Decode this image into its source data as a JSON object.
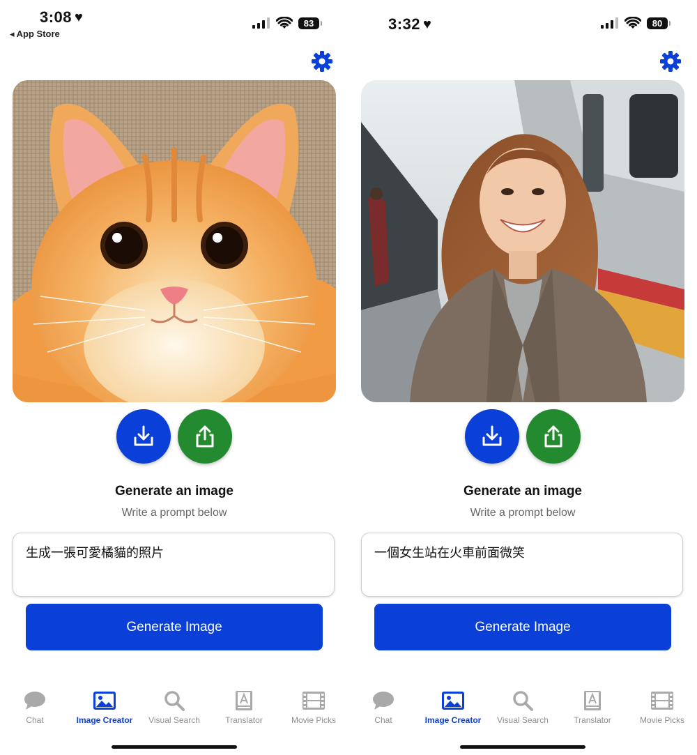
{
  "screens": [
    {
      "status": {
        "time": "3:08",
        "battery": "83",
        "back_label": "◂ App Store"
      },
      "image_alt": "orange cat",
      "title": "Generate an image",
      "subtitle": "Write a prompt below",
      "prompt_value": "生成一張可愛橘貓的照片",
      "generate_label": "Generate Image"
    },
    {
      "status": {
        "time": "3:32",
        "battery": "80"
      },
      "image_alt": "girl smiling in front of train",
      "title": "Generate an image",
      "subtitle": "Write a prompt below",
      "prompt_value": "一個女生站在火車前面微笑",
      "generate_label": "Generate Image"
    }
  ],
  "tabs": [
    {
      "label": "Chat",
      "icon": "chat-bubble-icon",
      "active": false
    },
    {
      "label": "Image Creator",
      "icon": "image-icon",
      "active": true
    },
    {
      "label": "Visual Search",
      "icon": "search-icon",
      "active": false
    },
    {
      "label": "Translator",
      "icon": "translator-book-icon",
      "active": false
    },
    {
      "label": "Movie Picks",
      "icon": "film-icon",
      "active": false
    }
  ],
  "colors": {
    "accent": "#0a3fd8",
    "share": "#238a2f",
    "inactive": "#8e8e8e"
  }
}
